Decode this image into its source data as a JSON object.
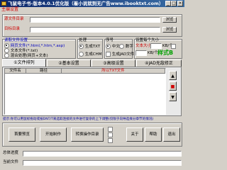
{
  "window": {
    "title": "飞鼠电子书-版本4.0.1优化版（着小说就到无广告www.ibooktxt.com）",
    "minimize": "_",
    "maximize": "□",
    "close": "×"
  },
  "menu": {
    "items": [
      "主编设置"
    ]
  },
  "dirs": {
    "source_label": "源文件目录",
    "target_label": "目标目录",
    "browse": "浏览"
  },
  "read": {
    "title": "读取文件设置",
    "opt1": "网页文件(*.html,*.htm,*.asp)",
    "opt2": "文本文件(*.txt)",
    "opt3": "混合处理(网页+文本)"
  },
  "process": {
    "title": "处理",
    "opt1": "生成TXT",
    "opt2": "生成CHM"
  },
  "order": {
    "title": "序号",
    "opt1": "中文",
    "opt2": "数字",
    "opt3": "生成JAD文件"
  },
  "tabs": [
    "①文件排列",
    "②基本设置",
    "③高级设置",
    "④JAD无敌修正"
  ],
  "fontsize": {
    "title": "设置每个大小",
    "label1": "文本大小",
    "unit1": "KB/个",
    "label2": "不分章节",
    "label3": "KB/个",
    "style_text": "样式B"
  },
  "list": {
    "col1": "文件名",
    "col2": "路径",
    "col3": "所以TXT文件"
  },
  "tip": "提示:你可以用鼠标拖动或按DNT/T来选取连接的文件进行复杂的上下调整(仅限于向导选择分章节的情况)",
  "buttons": {
    "open": "首要预览",
    "start": "开始制作",
    "convert": "转换操作目录",
    "about": "关于",
    "help": "帮助",
    "exit": "退出"
  },
  "side": {
    "up_icon": "▲",
    "down_icon": "▼",
    "stop_icon": "■"
  },
  "status": {
    "label1": "总体进度",
    "label2": "当前文件"
  },
  "colors": {
    "title_start": "#0a246a",
    "title_end": "#3a6ea5",
    "accent_red": "#d00000",
    "panel": "#d4d0c8"
  }
}
